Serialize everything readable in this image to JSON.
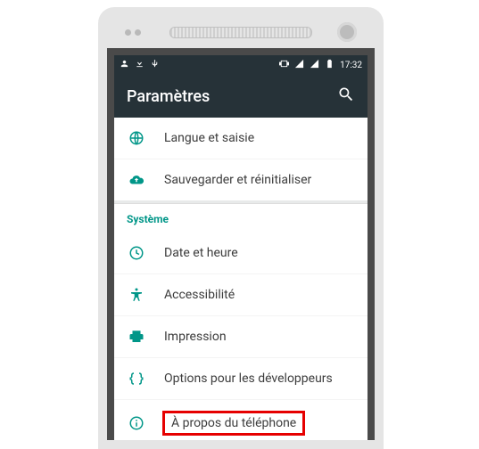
{
  "statusbar": {
    "time": "17:32"
  },
  "toolbar": {
    "title": "Paramètres"
  },
  "top_group": {
    "items": [
      {
        "label": "Langue et saisie"
      },
      {
        "label": "Sauvegarder et réinitialiser"
      }
    ]
  },
  "system": {
    "header": "Système",
    "items": [
      {
        "label": "Date et heure"
      },
      {
        "label": "Accessibilité"
      },
      {
        "label": "Impression"
      },
      {
        "label": "Options pour les développeurs"
      },
      {
        "label": "À propos du téléphone"
      }
    ]
  }
}
